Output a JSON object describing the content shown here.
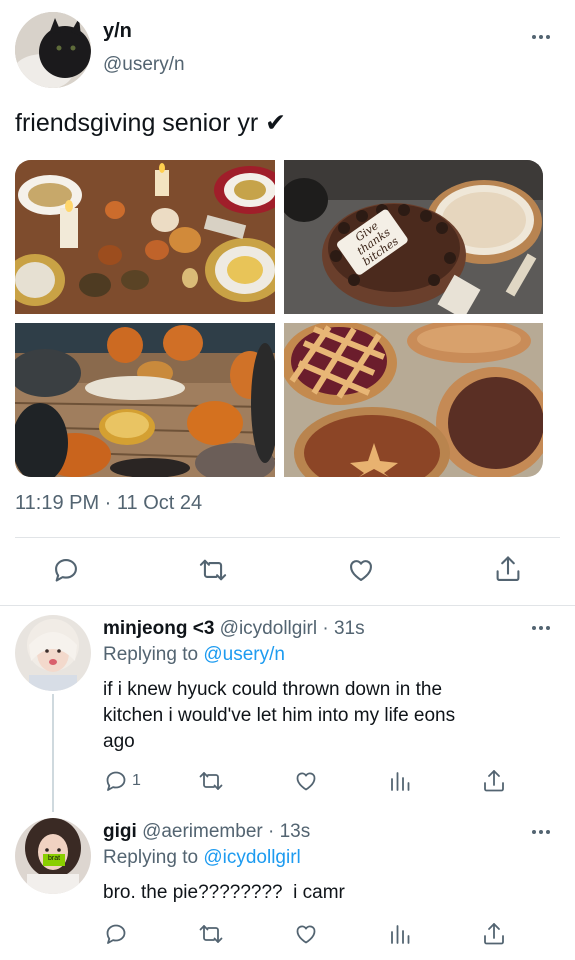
{
  "main_tweet": {
    "display_name": "y/n",
    "handle": "@usery/n",
    "text": "friendsgiving senior yr ✔",
    "timestamp": "11:19 PM · 11 Oct 24",
    "photos": [
      {
        "alt": "dinner table with pumpkins and candles"
      },
      {
        "alt": "chocolate cake with Give thanks bitches"
      },
      {
        "alt": "friends around pumpkins and food on floor"
      },
      {
        "alt": "several pies on a counter"
      }
    ],
    "cake_text_lines": [
      "Give",
      "thanks",
      "bitches"
    ]
  },
  "replies": [
    {
      "display_name": "minjeong <3",
      "handle": "@icydollgirl",
      "time": "· 31s",
      "replying_prefix": "Replying to",
      "replying_to": "@usery/n",
      "text_lines": [
        "if i knew hyuck could thrown down in the",
        "kitchen i would've let him into my life eons",
        "ago"
      ],
      "reply_count": "1"
    },
    {
      "display_name": "gigi",
      "handle": "@aerimember",
      "time": "· 13s",
      "replying_prefix": "Replying to",
      "replying_to": "@icydollgirl",
      "text_lines": [
        "bro. the pie????????  i camr"
      ],
      "reply_count": "",
      "avatar_badge": "brat"
    }
  ],
  "icons": [
    "more-icon",
    "reply-icon",
    "retweet-icon",
    "like-icon",
    "share-icon",
    "views-icon"
  ],
  "colors": {
    "accent": "#1d9bf0",
    "muted": "#536471",
    "text": "#0f1419"
  }
}
